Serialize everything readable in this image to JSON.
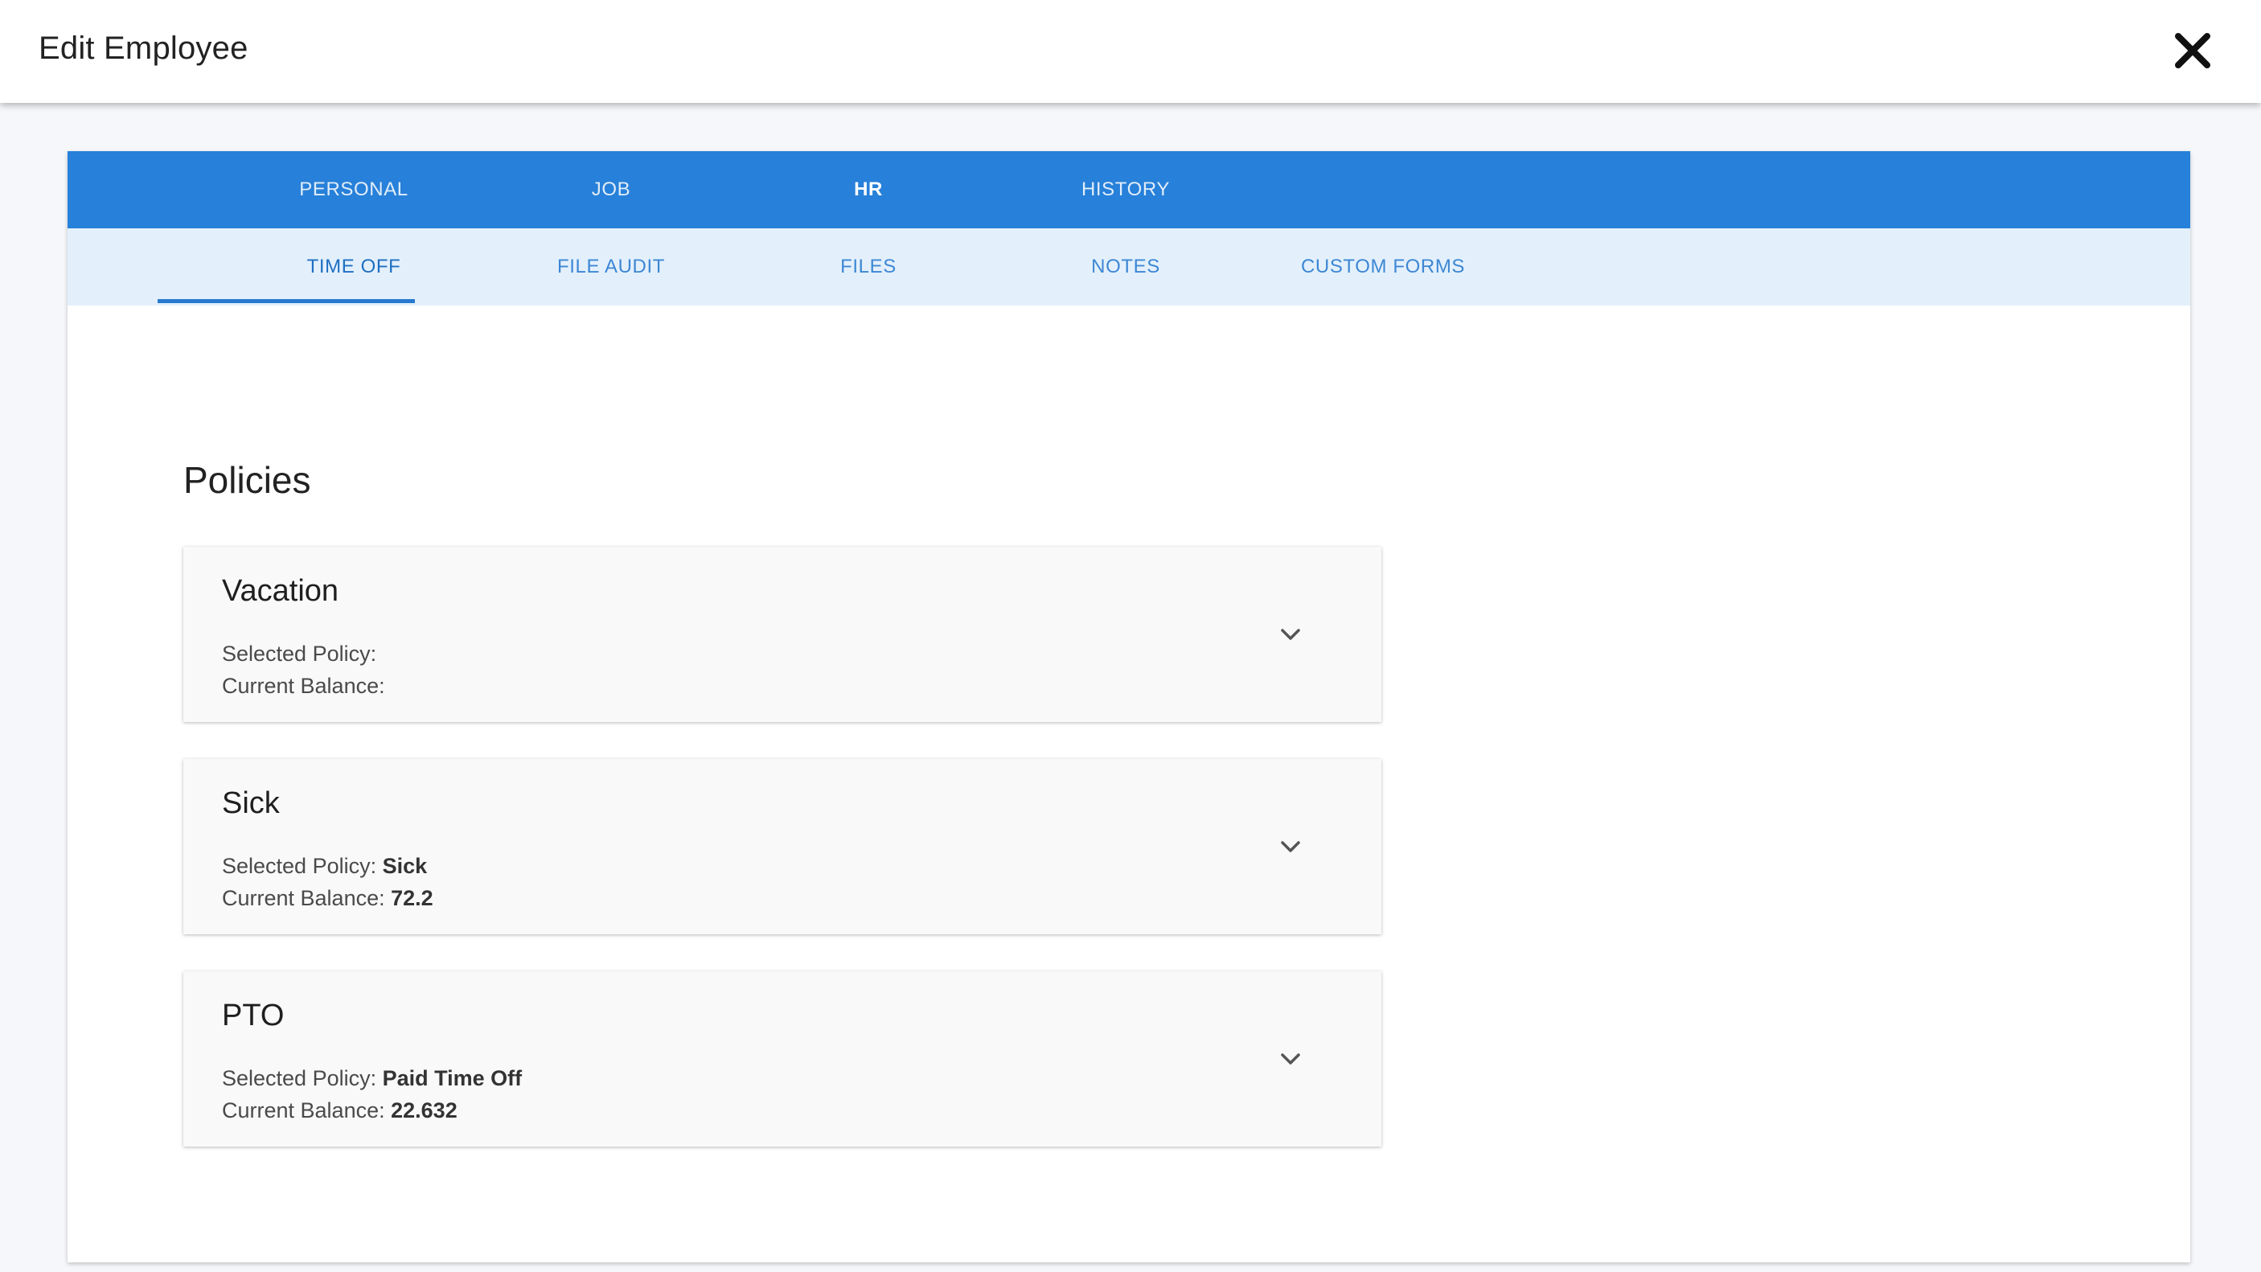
{
  "header": {
    "title": "Edit Employee",
    "close_icon": "close-icon"
  },
  "primary_tabs": [
    {
      "label": "PERSONAL",
      "active": false
    },
    {
      "label": "JOB",
      "active": false
    },
    {
      "label": "HR",
      "active": true
    },
    {
      "label": "HISTORY",
      "active": false
    }
  ],
  "secondary_tabs": [
    {
      "label": "TIME OFF",
      "active": true
    },
    {
      "label": "FILE AUDIT",
      "active": false
    },
    {
      "label": "FILES",
      "active": false
    },
    {
      "label": "NOTES",
      "active": false
    },
    {
      "label": "CUSTOM FORMS",
      "active": false
    }
  ],
  "section": {
    "title": "Policies"
  },
  "policies": [
    {
      "name": "Vacation",
      "selected_label": "Selected Policy:",
      "selected_value": "",
      "balance_label": "Current Balance:",
      "balance_value": ""
    },
    {
      "name": "Sick",
      "selected_label": "Selected Policy:",
      "selected_value": "Sick",
      "balance_label": "Current Balance:",
      "balance_value": "72.2"
    },
    {
      "name": "PTO",
      "selected_label": "Selected Policy:",
      "selected_value": "Paid Time Off",
      "balance_label": "Current Balance:",
      "balance_value": "22.632"
    }
  ],
  "colors": {
    "primary_tab_bar": "#2780d9",
    "secondary_tab_bar": "#e3f0fc",
    "active_indicator": "#2779d0"
  }
}
